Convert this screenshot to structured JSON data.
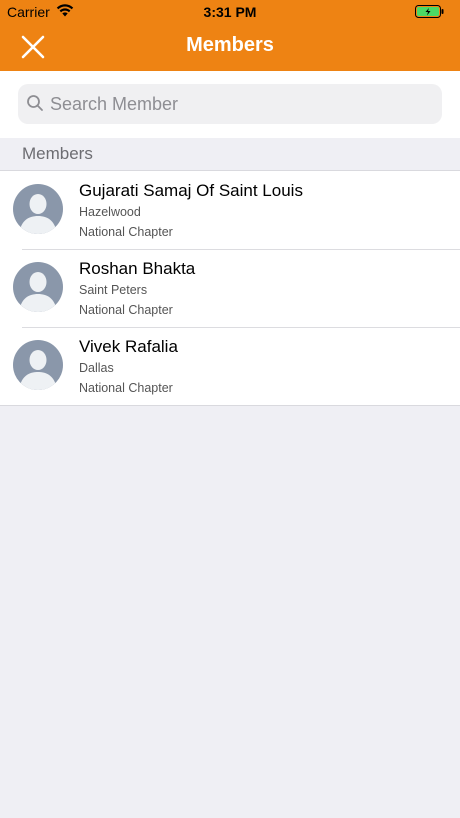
{
  "status_bar": {
    "carrier": "Carrier",
    "time": "3:31 PM"
  },
  "nav": {
    "title": "Members",
    "close_icon": "close-icon",
    "background_color": "#ee8313"
  },
  "search": {
    "placeholder": "Search Member",
    "value": ""
  },
  "section": {
    "title": "Members"
  },
  "members": [
    {
      "name": "Gujarati Samaj Of Saint Louis",
      "location": "Hazelwood",
      "chapter": "National Chapter"
    },
    {
      "name": "Roshan Bhakta",
      "location": "Saint Peters",
      "chapter": "National Chapter"
    },
    {
      "name": "Vivek Rafalia",
      "location": "Dallas",
      "chapter": "National Chapter"
    }
  ]
}
